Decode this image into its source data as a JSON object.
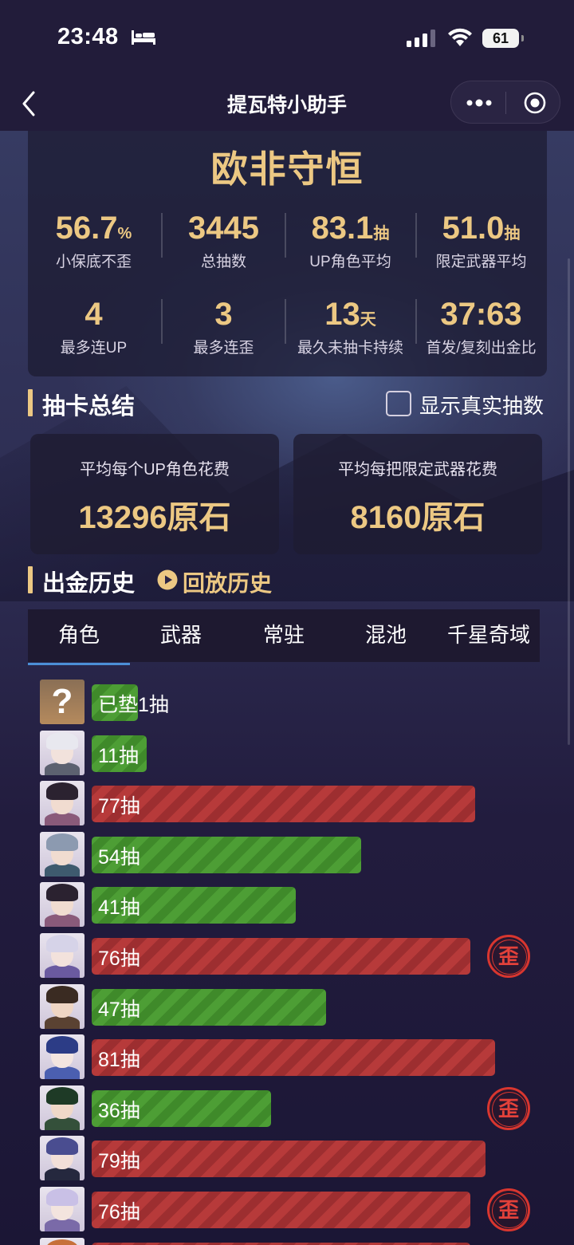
{
  "status_bar": {
    "time": "23:48",
    "battery": "61"
  },
  "nav": {
    "title": "提瓦特小助手"
  },
  "summary": {
    "rank_title": "欧非守恒",
    "stats": [
      {
        "value": "56.7",
        "unit": "%",
        "label": "小保底不歪"
      },
      {
        "value": "3445",
        "unit": "",
        "label": "总抽数"
      },
      {
        "value": "83.1",
        "unit": "抽",
        "label": "UP角色平均"
      },
      {
        "value": "51.0",
        "unit": "抽",
        "label": "限定武器平均"
      },
      {
        "value": "4",
        "unit": "",
        "label": "最多连UP"
      },
      {
        "value": "3",
        "unit": "",
        "label": "最多连歪"
      },
      {
        "value": "13",
        "unit": "天",
        "label": "最久未抽卡持续"
      },
      {
        "value": "37:63",
        "unit": "",
        "label": "首发/复刻出金比"
      }
    ]
  },
  "draw_summary": {
    "title": "抽卡总结",
    "checkbox_label": "显示真实抽数",
    "checkbox_checked": false,
    "cards": [
      {
        "label": "平均每个UP角色花费",
        "value": "13296原石"
      },
      {
        "label": "平均每把限定武器花费",
        "value": "8160原石"
      }
    ]
  },
  "gold_history": {
    "title": "出金历史",
    "replay_label": "回放历史",
    "tabs": [
      "角色",
      "武器",
      "常驻",
      "混池",
      "千星奇域"
    ],
    "active_tab": 0,
    "stamp_text": "歪",
    "rows": [
      {
        "label": "已垫1抽",
        "pulls": 1,
        "color": "green",
        "lost_5050": false,
        "avatar": "unknown"
      },
      {
        "label": "11抽",
        "pulls": 11,
        "color": "green",
        "lost_5050": false,
        "avatar": "white-hair"
      },
      {
        "label": "77抽",
        "pulls": 77,
        "color": "red",
        "lost_5050": false,
        "avatar": "dark-hair-pink"
      },
      {
        "label": "54抽",
        "pulls": 54,
        "color": "green",
        "lost_5050": false,
        "avatar": "grey-blue-hair"
      },
      {
        "label": "41抽",
        "pulls": 41,
        "color": "green",
        "lost_5050": false,
        "avatar": "dark-hair-pink"
      },
      {
        "label": "76抽",
        "pulls": 76,
        "color": "red",
        "lost_5050": true,
        "avatar": "silver-purple-hair"
      },
      {
        "label": "47抽",
        "pulls": 47,
        "color": "green",
        "lost_5050": false,
        "avatar": "brown-hair"
      },
      {
        "label": "81抽",
        "pulls": 81,
        "color": "red",
        "lost_5050": false,
        "avatar": "white-blue-hat"
      },
      {
        "label": "36抽",
        "pulls": 36,
        "color": "green",
        "lost_5050": true,
        "avatar": "green-hair"
      },
      {
        "label": "79抽",
        "pulls": 79,
        "color": "red",
        "lost_5050": false,
        "avatar": "indigo-hair"
      },
      {
        "label": "76抽",
        "pulls": 76,
        "color": "red",
        "lost_5050": true,
        "avatar": "lilac-hair"
      },
      {
        "label": "",
        "pulls": 76,
        "color": "red",
        "lost_5050": false,
        "avatar": "orange-hair"
      }
    ]
  },
  "colors": {
    "gold": "#ecc883",
    "green_bar": "#4d9e35",
    "red_bar": "#b73a3a",
    "stamp_red": "#d8362f",
    "tab_underline": "#4c8fd6"
  }
}
